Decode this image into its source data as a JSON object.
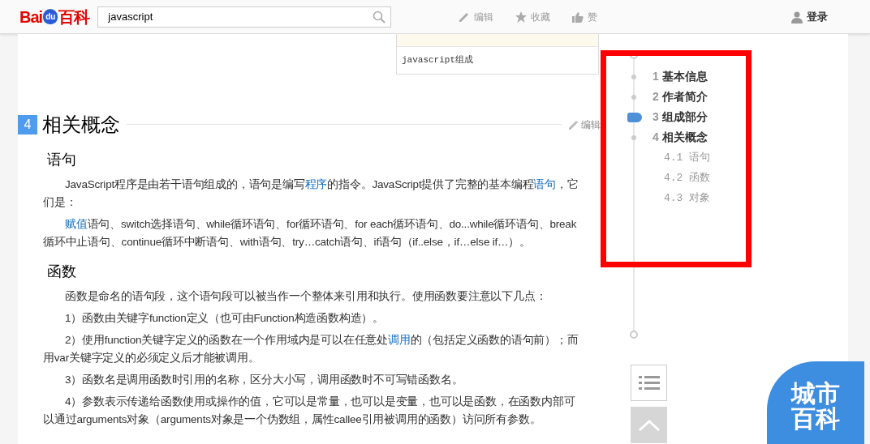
{
  "header": {
    "logo": {
      "left": "Bai",
      "paw": "du",
      "right": "百科"
    },
    "search": {
      "value": "javascript"
    },
    "actions": [
      {
        "kind": "edit",
        "label": "编辑"
      },
      {
        "kind": "star",
        "label": "收藏"
      },
      {
        "kind": "like",
        "label": "赞"
      }
    ],
    "login": "登录"
  },
  "figure": {
    "caption": "javascript组成"
  },
  "section": {
    "number": "4",
    "title": "相关概念",
    "edit": "编辑",
    "subsections": [
      {
        "title": "语句",
        "paragraphs": [
          [
            {
              "text": "JavaScript程序是由若干语句组成的，语句是编写"
            },
            {
              "text": "程序",
              "link": true
            },
            {
              "text": "的指令。JavaScript提供了完整的基本编程"
            },
            {
              "text": "语句",
              "link": true
            },
            {
              "text": "，它们是："
            }
          ],
          [
            {
              "text": "赋值",
              "link": true
            },
            {
              "text": "语句、switch选择语句、while循环语句、for循环语句、for each循环语句、do...while循环语句、break循环中止语句、continue循环中断语句、with语句、try…catch语句、if语句（if..else，if…else if…）。"
            }
          ]
        ]
      },
      {
        "title": "函数",
        "paragraphs": [
          [
            {
              "text": "函数是命名的语句段，这个语句段可以被当作一个整体来引用和执行。使用函数要注意以下几点："
            }
          ],
          [
            {
              "text": "1）函数由关键字function定义（也可由Function构造函数构造）。"
            }
          ],
          [
            {
              "text": "2）使用function关键字定义的函数在一个作用域内是可以在任意处"
            },
            {
              "text": "调用",
              "link": true
            },
            {
              "text": "的（包括定义函数的语句前）；而用var关键字定义的必须定义后才能被调用。"
            }
          ],
          [
            {
              "text": "3）函数名是调用函数时引用的名称，区分大小写，调用函数时不可写错函数名。"
            }
          ],
          [
            {
              "text": "4）参数表示传递给函数使用或操作的值，它可以是常量，也可以是变量，也可以是函数，在函数内部可以通过arguments对象（arguments对象是一个伪数组，属性callee引用被调用的函数）访问所有参数。"
            }
          ]
        ]
      }
    ]
  },
  "toc": {
    "items": [
      {
        "number": "1",
        "label": "基本信息",
        "selected": false
      },
      {
        "number": "2",
        "label": "作者简介",
        "selected": false
      },
      {
        "number": "3",
        "label": "组成部分",
        "selected": true
      },
      {
        "number": "4",
        "label": "相关概念",
        "selected": false,
        "children": [
          {
            "number": "4.1",
            "label": "语句"
          },
          {
            "number": "4.2",
            "label": "函数"
          },
          {
            "number": "4.3",
            "label": "对象"
          }
        ]
      }
    ]
  },
  "badge": {
    "line1": "城市",
    "line2": "百科"
  }
}
